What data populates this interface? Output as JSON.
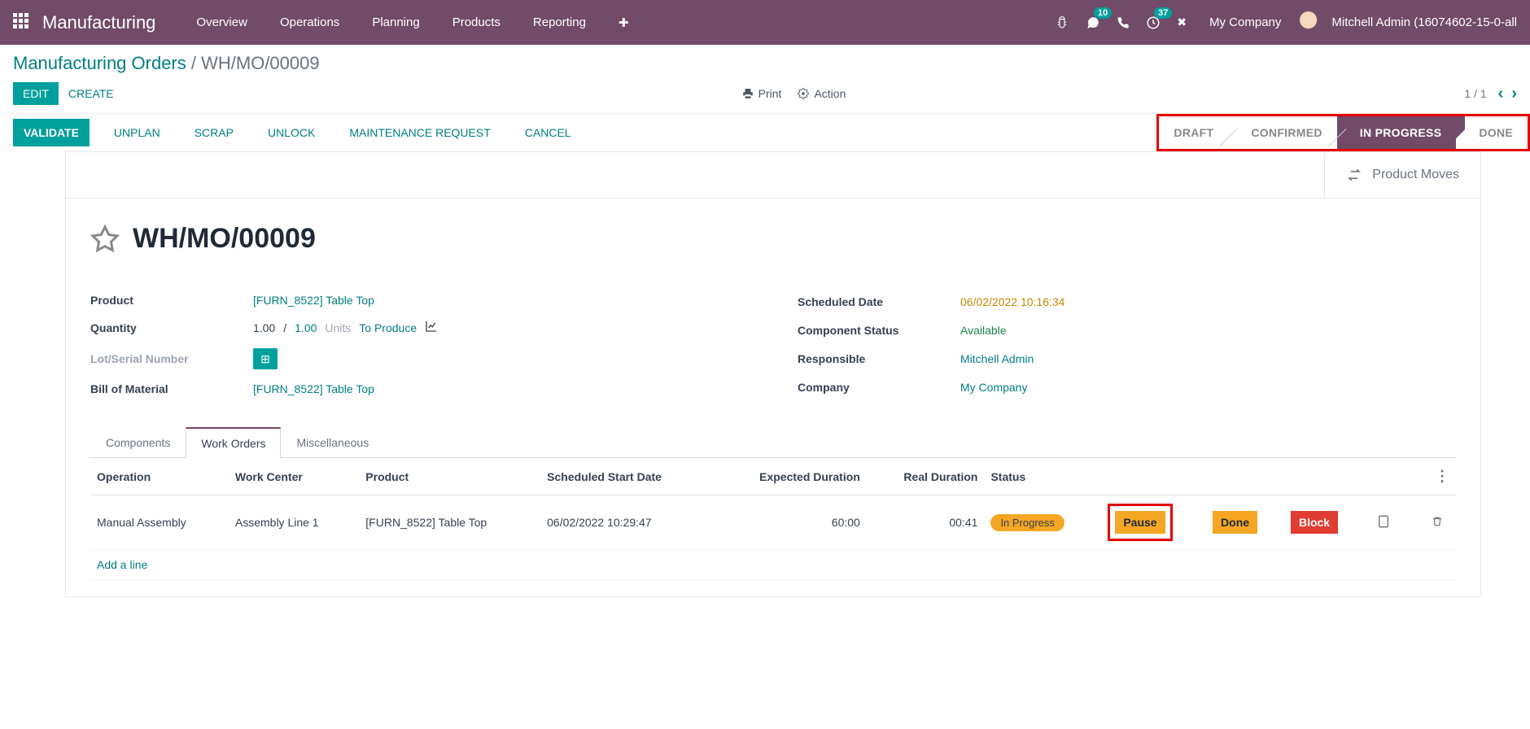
{
  "topnav": {
    "brand": "Manufacturing",
    "menu": [
      "Overview",
      "Operations",
      "Planning",
      "Products",
      "Reporting"
    ],
    "badges": {
      "messages": "10",
      "activities": "37"
    },
    "company": "My Company",
    "user": "Mitchell Admin (16074602-15-0-all"
  },
  "breadcrumb": {
    "parent": "Manufacturing Orders",
    "current": "WH/MO/00009"
  },
  "toolbar": {
    "edit": "EDIT",
    "create": "CREATE",
    "print": "Print",
    "action": "Action",
    "pager": "1 / 1"
  },
  "statusbar": {
    "buttons": [
      "VALIDATE",
      "UNPLAN",
      "SCRAP",
      "UNLOCK",
      "MAINTENANCE REQUEST",
      "CANCEL"
    ],
    "steps": [
      "DRAFT",
      "CONFIRMED",
      "IN PROGRESS",
      "DONE"
    ],
    "active_step": 2
  },
  "stat": {
    "product_moves": "Product Moves"
  },
  "record": {
    "title": "WH/MO/00009",
    "fields_left": {
      "product_label": "Product",
      "product_value": "[FURN_8522] Table Top",
      "quantity_label": "Quantity",
      "quantity_a": "1.00",
      "quantity_sep": "/",
      "quantity_b": "1.00",
      "quantity_uom": "Units",
      "quantity_status": "To Produce",
      "lot_label": "Lot/Serial Number",
      "bom_label": "Bill of Material",
      "bom_value": "[FURN_8522] Table Top"
    },
    "fields_right": {
      "sched_label": "Scheduled Date",
      "sched_value": "06/02/2022 10:16:34",
      "comp_label": "Component Status",
      "comp_value": "Available",
      "resp_label": "Responsible",
      "resp_value": "Mitchell Admin",
      "company_label": "Company",
      "company_value": "My Company"
    }
  },
  "tabs": [
    "Components",
    "Work Orders",
    "Miscellaneous"
  ],
  "active_tab": 1,
  "wo_table": {
    "headers": [
      "Operation",
      "Work Center",
      "Product",
      "Scheduled Start Date",
      "Expected Duration",
      "Real Duration",
      "Status"
    ],
    "row": {
      "operation": "Manual Assembly",
      "work_center": "Assembly Line 1",
      "product": "[FURN_8522] Table Top",
      "sched": "06/02/2022 10:29:47",
      "expected": "60:00",
      "real": "00:41",
      "status": "In Progress",
      "pause": "Pause",
      "done": "Done",
      "block": "Block"
    },
    "add_line": "Add a line"
  }
}
